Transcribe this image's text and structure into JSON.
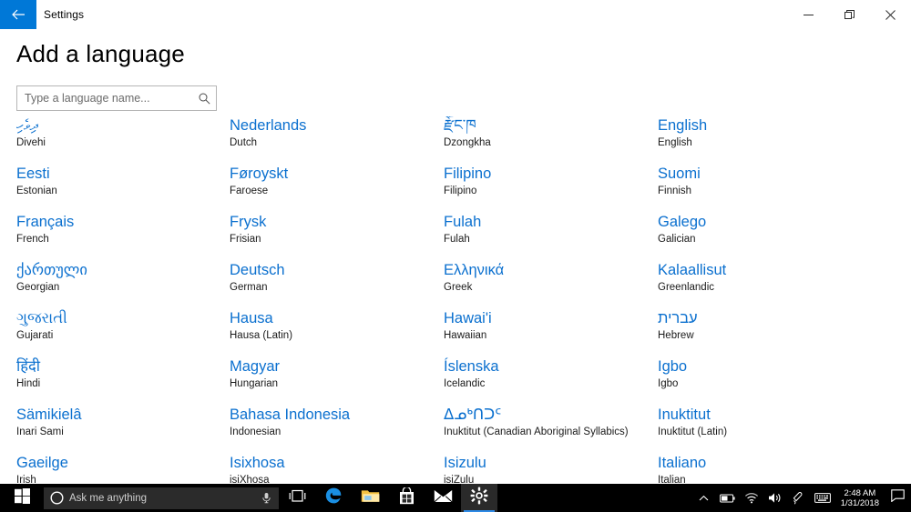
{
  "window": {
    "app_title": "Settings",
    "back_icon": "back-arrow-icon",
    "minimize_icon": "minimize-icon",
    "restore_icon": "restore-icon",
    "close_icon": "close-icon",
    "accent_color": "#0078d7"
  },
  "page": {
    "title": "Add a language",
    "link_color": "#0b70cf"
  },
  "search": {
    "placeholder": "Type a language name...",
    "value": "",
    "icon": "search-icon"
  },
  "languages": {
    "columns": [
      [
        {
          "native": "ދިވެހި",
          "english": "Divehi"
        },
        {
          "native": "Eesti",
          "english": "Estonian"
        },
        {
          "native": "Français",
          "english": "French"
        },
        {
          "native": "ქართული",
          "english": "Georgian"
        },
        {
          "native": "ગુજરાતી",
          "english": "Gujarati"
        },
        {
          "native": "हिंदी",
          "english": "Hindi"
        },
        {
          "native": "Sämikielâ",
          "english": "Inari Sami"
        },
        {
          "native": "Gaeilge",
          "english": "Irish"
        }
      ],
      [
        {
          "native": "Nederlands",
          "english": "Dutch"
        },
        {
          "native": "Føroyskt",
          "english": "Faroese"
        },
        {
          "native": "Frysk",
          "english": "Frisian"
        },
        {
          "native": "Deutsch",
          "english": "German"
        },
        {
          "native": "Hausa",
          "english": "Hausa (Latin)"
        },
        {
          "native": "Magyar",
          "english": "Hungarian"
        },
        {
          "native": "Bahasa Indonesia",
          "english": "Indonesian"
        },
        {
          "native": "Isixhosa",
          "english": "isiXhosa"
        }
      ],
      [
        {
          "native": "རྫོང་ཁ",
          "english": "Dzongkha"
        },
        {
          "native": "Filipino",
          "english": "Filipino"
        },
        {
          "native": "Fulah",
          "english": "Fulah"
        },
        {
          "native": "Ελληνικά",
          "english": "Greek"
        },
        {
          "native": "Hawai'i",
          "english": "Hawaiian"
        },
        {
          "native": "Íslenska",
          "english": "Icelandic"
        },
        {
          "native": "ᐃᓄᒃᑎᑐᑦ",
          "english": "Inuktitut (Canadian Aboriginal Syllabics)"
        },
        {
          "native": "Isizulu",
          "english": "isiZulu"
        }
      ],
      [
        {
          "native": "English",
          "english": "English"
        },
        {
          "native": "Suomi",
          "english": "Finnish"
        },
        {
          "native": "Galego",
          "english": "Galician"
        },
        {
          "native": "Kalaallisut",
          "english": "Greenlandic"
        },
        {
          "native": "עברית",
          "english": "Hebrew"
        },
        {
          "native": "Igbo",
          "english": "Igbo"
        },
        {
          "native": "Inuktitut",
          "english": "Inuktitut (Latin)"
        },
        {
          "native": "Italiano",
          "english": "Italian"
        }
      ]
    ]
  },
  "taskbar": {
    "start_icon": "windows-start-icon",
    "cortana_icon": "cortana-circle-icon",
    "search_placeholder": "Ask me anything",
    "mic_icon": "microphone-icon",
    "taskview_icon": "task-view-icon",
    "apps": [
      {
        "name": "edge-icon",
        "label": "Microsoft Edge"
      },
      {
        "name": "file-explorer-icon",
        "label": "File Explorer"
      },
      {
        "name": "microsoft-store-icon",
        "label": "Microsoft Store"
      },
      {
        "name": "mail-icon",
        "label": "Mail"
      },
      {
        "name": "settings-gear-icon",
        "label": "Settings"
      }
    ],
    "tray": [
      {
        "name": "show-hidden-icons-chevron"
      },
      {
        "name": "battery-icon"
      },
      {
        "name": "wifi-icon"
      },
      {
        "name": "volume-icon"
      },
      {
        "name": "bluetooth-pen-icon"
      },
      {
        "name": "touch-keyboard-icon"
      }
    ],
    "clock": {
      "time": "2:48 AM",
      "date": "1/31/2018"
    },
    "action_center_icon": "action-center-icon"
  }
}
